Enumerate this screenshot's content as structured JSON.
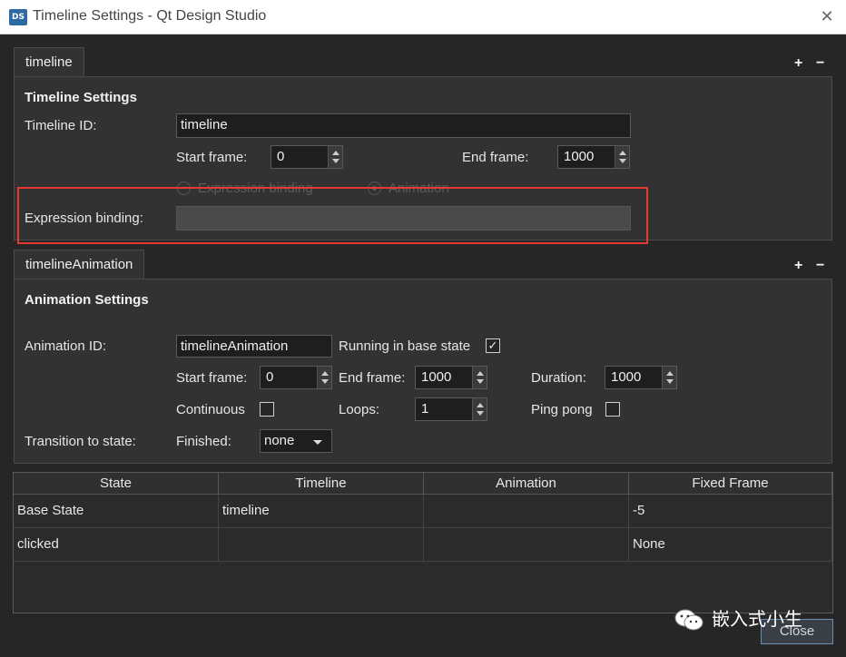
{
  "window": {
    "title": "Timeline Settings - Qt Design Studio",
    "icon_text": "DS",
    "close_glyph": "✕"
  },
  "timeline_tab": {
    "label": "timeline",
    "add_glyph": "+",
    "remove_glyph": "−"
  },
  "timeline_settings": {
    "header": "Timeline Settings",
    "id_label": "Timeline ID:",
    "id_value": "timeline",
    "start_label": "Start frame:",
    "start_value": "0",
    "end_label": "End frame:",
    "end_value": "1000",
    "radio_expression": "Expression binding",
    "radio_animation": "Animation",
    "binding_label": "Expression binding:",
    "binding_value": ""
  },
  "animation_tab": {
    "label": "timelineAnimation",
    "add_glyph": "+",
    "remove_glyph": "−"
  },
  "animation_settings": {
    "header": "Animation Settings",
    "id_label": "Animation ID:",
    "id_value": "timelineAnimation",
    "running_label": "Running in base state",
    "running_checked": true,
    "start_label": "Start frame:",
    "start_value": "0",
    "end_label": "End frame:",
    "end_value": "1000",
    "duration_label": "Duration:",
    "duration_value": "1000",
    "continuous_label": "Continuous",
    "continuous_checked": false,
    "loops_label": "Loops:",
    "loops_value": "1",
    "pingpong_label": "Ping pong",
    "pingpong_checked": false,
    "transition_label": "Transition to state:",
    "finished_label": "Finished:",
    "finished_value": "none"
  },
  "state_table": {
    "headers": [
      "State",
      "Timeline",
      "Animation",
      "Fixed Frame"
    ],
    "rows": [
      [
        "Base State",
        "timeline",
        "",
        "-5"
      ],
      [
        "clicked",
        "",
        "",
        "None"
      ]
    ]
  },
  "footer": {
    "close_label": "Close"
  },
  "watermark": {
    "text": "嵌入式小生"
  },
  "colors": {
    "background": "#262626",
    "panel": "#323232",
    "highlight_box": "#e53935"
  }
}
